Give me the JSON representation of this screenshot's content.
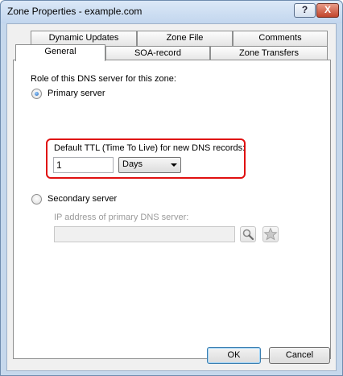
{
  "window": {
    "title": "Zone Properties - example.com",
    "help_label": "?",
    "close_label": "X"
  },
  "tabs": [
    {
      "label": "Dynamic Updates"
    },
    {
      "label": "Zone File"
    },
    {
      "label": "Comments"
    },
    {
      "label": "General"
    },
    {
      "label": "SOA-record"
    },
    {
      "label": "Zone Transfers"
    }
  ],
  "active_tab": "General",
  "general": {
    "role_label": "Role of this DNS server for this zone:",
    "primary_label": "Primary server",
    "primary_selected": true,
    "ttl_label": "Default TTL (Time To Live) for new DNS records:",
    "ttl_value": "1",
    "ttl_unit": "Days",
    "secondary_label": "Secondary server",
    "ip_label": "IP address of primary DNS server:",
    "ip_value": ""
  },
  "icons": {
    "lookup": "magnifier-icon",
    "favorite": "star-icon"
  },
  "buttons": {
    "ok": "OK",
    "cancel": "Cancel"
  },
  "colors": {
    "highlight": "#e01010",
    "title_bg": "#c6d8ec",
    "close_bg": "#c1452c"
  }
}
